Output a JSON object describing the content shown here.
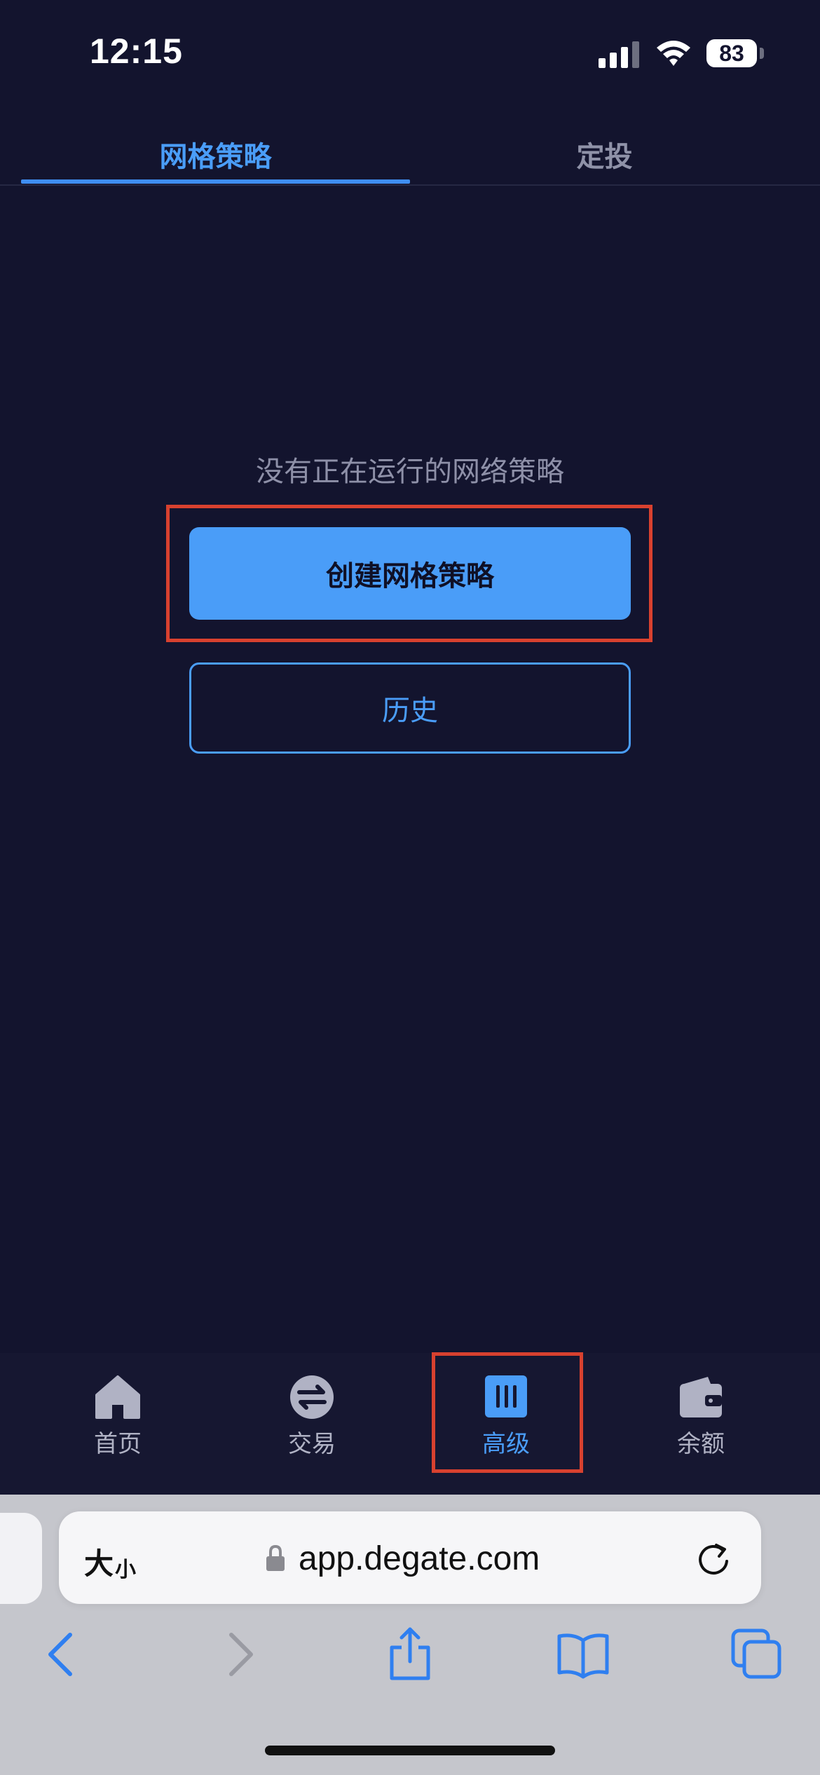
{
  "status_bar": {
    "time": "12:15",
    "battery": "83"
  },
  "tabs": [
    {
      "label": "网格策略",
      "active": true
    },
    {
      "label": "定投",
      "active": false
    }
  ],
  "empty_state": {
    "message": "没有正在运行的网络策略",
    "primary_button": "创建网格策略",
    "secondary_button": "历史"
  },
  "bottom_nav": [
    {
      "label": "首页",
      "icon": "home-icon"
    },
    {
      "label": "交易",
      "icon": "swap-icon"
    },
    {
      "label": "高级",
      "icon": "bars-icon",
      "active": true
    },
    {
      "label": "余额",
      "icon": "wallet-icon"
    }
  ],
  "browser": {
    "text_size_label_large": "大",
    "text_size_label_small": "小",
    "url": "app.degate.com"
  },
  "colors": {
    "background": "#13142e",
    "accent": "#4a9df8",
    "highlight": "#d8412f"
  }
}
